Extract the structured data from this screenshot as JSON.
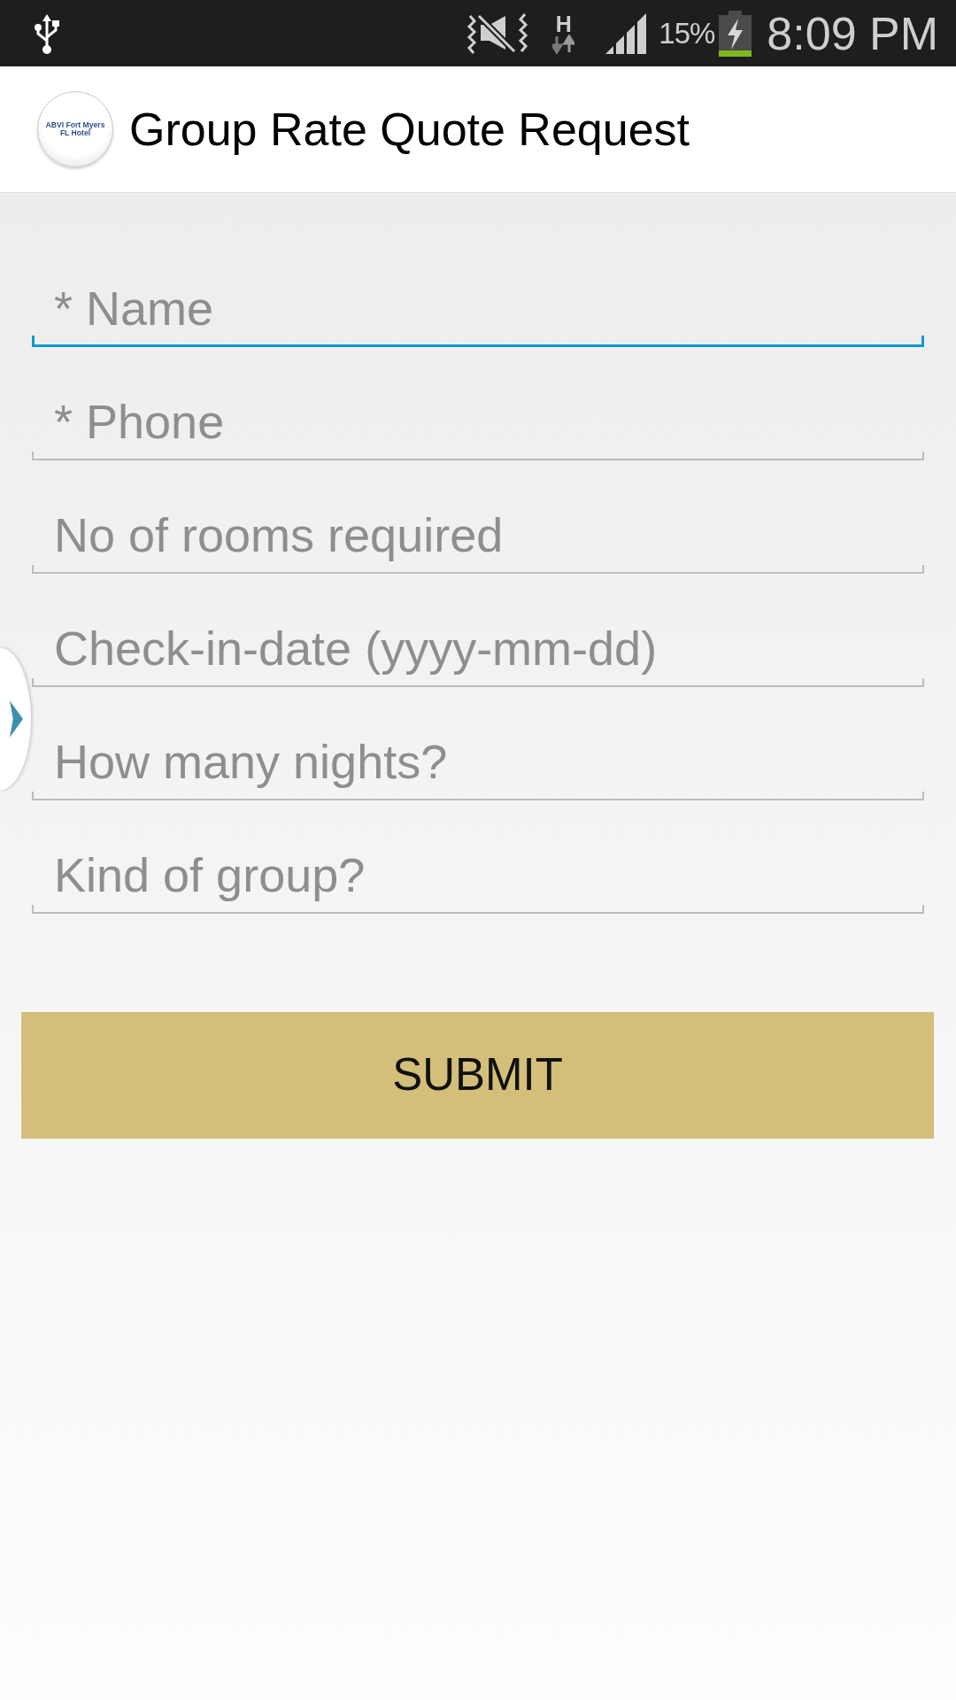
{
  "status_bar": {
    "network_type": "H",
    "battery": "15%",
    "time": "8:09 PM"
  },
  "app_bar": {
    "logo_lines": [
      "ABVI Fort Myers",
      "FL Hotel"
    ],
    "title": "Group Rate Quote Request"
  },
  "form": {
    "fields": [
      {
        "placeholder": "* Name",
        "focused": true
      },
      {
        "placeholder": "* Phone",
        "focused": false
      },
      {
        "placeholder": "No of rooms required",
        "focused": false
      },
      {
        "placeholder": "Check-in-date (yyyy-mm-dd)",
        "focused": false
      },
      {
        "placeholder": "How many nights?",
        "focused": false
      },
      {
        "placeholder": "Kind of group?",
        "focused": false
      }
    ],
    "submit": "SUBMIT"
  }
}
